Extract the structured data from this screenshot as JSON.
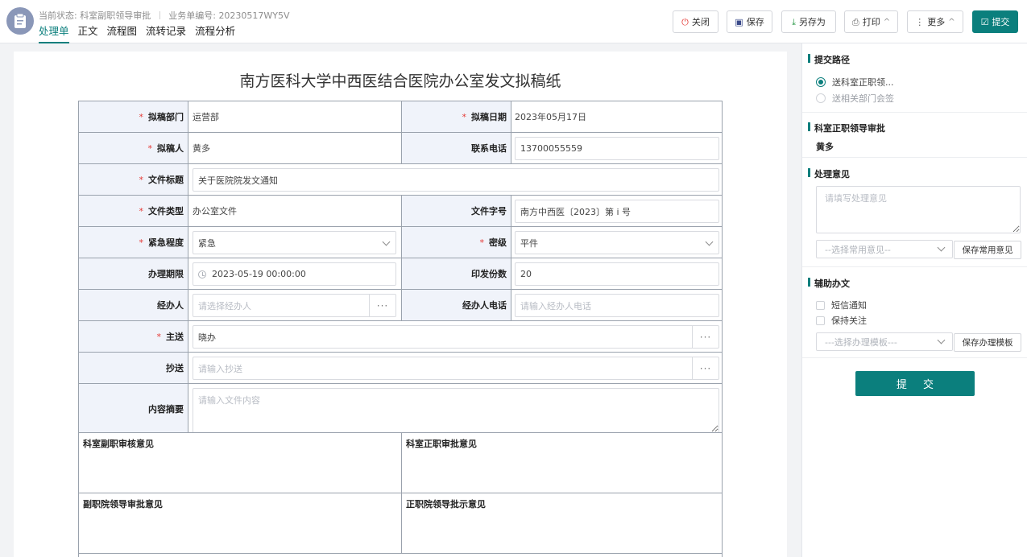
{
  "header": {
    "status_prefix": "当前状态:",
    "status_value": "科室副职领导审批",
    "serial_prefix": "业务单编号:",
    "serial_value": "20230517WY5V",
    "tabs": [
      {
        "label": "处理单",
        "active": true
      },
      {
        "label": "正文",
        "active": false
      },
      {
        "label": "流程图",
        "active": false
      },
      {
        "label": "流转记录",
        "active": false
      },
      {
        "label": "流程分析",
        "active": false
      }
    ],
    "toolbar": {
      "close": {
        "label": "关闭",
        "icon": "power-icon",
        "glyph": "⏻"
      },
      "save": {
        "label": "保存",
        "icon": "save-icon",
        "glyph": "▣"
      },
      "save_as": {
        "label": "另存为",
        "icon": "download-icon",
        "glyph": "⤓"
      },
      "print": {
        "label": "打印",
        "icon": "print-icon",
        "glyph": "⎙",
        "caret": "^"
      },
      "more": {
        "label": "更多",
        "icon": "more-vertical-icon",
        "glyph": "⋮",
        "caret": "^"
      },
      "submit": {
        "label": "提交",
        "icon": "check-square-icon",
        "glyph": "☑"
      }
    }
  },
  "form": {
    "title": "南方医科大学中西医结合医院办公室发文拟稿纸",
    "required_mark": "*",
    "fields": {
      "draft_dept": {
        "label": "拟稿部门",
        "value": "运营部"
      },
      "draft_date": {
        "label": "拟稿日期",
        "value": "2023年05月17日"
      },
      "drafter": {
        "label": "拟稿人",
        "value": "黄多"
      },
      "phone": {
        "label": "联系电话",
        "value": "13700055559"
      },
      "doc_title": {
        "label": "文件标题",
        "value": "关于医院院发文通知"
      },
      "doc_type": {
        "label": "文件类型",
        "value": "办公室文件"
      },
      "doc_number": {
        "label": "文件字号",
        "value": "南方中西医〔2023〕第 i 号"
      },
      "urgency": {
        "label": "紧急程度",
        "value": "紧急"
      },
      "secrecy": {
        "label": "密级",
        "value": "平件"
      },
      "deadline": {
        "label": "办理期限",
        "value": "2023-05-19 00:00:00"
      },
      "copies": {
        "label": "印发份数",
        "value": "20"
      },
      "handler": {
        "label": "经办人",
        "placeholder": "请选择经办人",
        "button": "···"
      },
      "handler_phone": {
        "label": "经办人电话",
        "placeholder": "请输入经办人电话"
      },
      "main_recipient": {
        "label": "主送",
        "value": "晓办",
        "button": "···"
      },
      "cc": {
        "label": "抄送",
        "placeholder": "请输入抄送",
        "button": "···"
      },
      "summary": {
        "label": "内容摘要",
        "placeholder": "请输入文件内容"
      }
    },
    "opinions": {
      "dept_deputy": "科室副职审核意见",
      "dept_head": "科室正职审批意见",
      "vp": "副职院领导审批意见",
      "president": "正职院领导批示意见"
    }
  },
  "sidebar": {
    "route": {
      "title": "提交路径",
      "options": [
        {
          "label": "送科室正职领...",
          "selected": true
        },
        {
          "label": "送相关部门会签",
          "selected": false
        }
      ]
    },
    "approver": {
      "title": "科室正职领导审批",
      "name": "黄多"
    },
    "opinion": {
      "title": "处理意见",
      "placeholder": "请填写处理意见",
      "common_select": "--选择常用意见--",
      "save_common": "保存常用意见"
    },
    "assist": {
      "title": "辅助办文",
      "checks": [
        {
          "label": "短信通知",
          "checked": false
        },
        {
          "label": "保持关注",
          "checked": false
        }
      ],
      "template_select": "---选择办理模板---",
      "save_template": "保存办理模板"
    },
    "submit_label": "提 交"
  }
}
